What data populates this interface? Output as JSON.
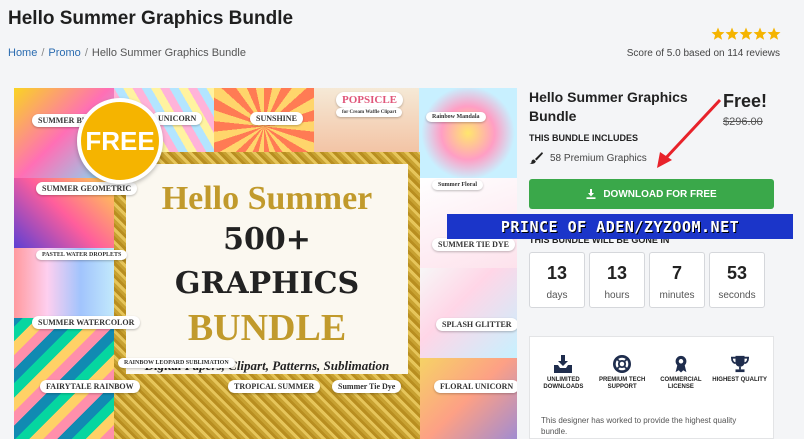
{
  "page": {
    "title": "Hello Summer Graphics Bundle",
    "rating_text": "Score of 5.0 based on 114 reviews"
  },
  "breadcrumb": {
    "home": "Home",
    "promo": "Promo",
    "current": "Hello Summer Graphics Bundle"
  },
  "hero": {
    "free_badge": "FREE",
    "line1": "Hello Summer",
    "line2": "500+ GRAPHICS",
    "line3": "BUNDLE",
    "line4": "Digital Papers, Clipart, Patterns, Sublimation",
    "tile_labels": [
      "SUMMER BU...",
      "UNICORN",
      "SUNSHINE",
      "POPSICLE",
      "for Cream Waffle Clipart",
      "Rainbow Mandala",
      "SUMMER GEOMETRIC",
      "Summer Floral",
      "SUMMER TIE DYE",
      "PASTEL WATER DROPLETS",
      "SUMMER WATERCOLOR",
      "SPLASH GLITTER",
      "FAIRYTALE RAINBOW",
      "RAINBOW LEOPARD SUBLIMATION",
      "TROPICAL SUMMER",
      "Summer Tie Dye",
      "FLORAL UNICORN"
    ]
  },
  "panel": {
    "title": "Hello Summer Graphics Bundle",
    "free_label": "Free!",
    "old_price": "$296.00",
    "includes_label": "THIS BUNDLE INCLUDES",
    "count_label": "58 Premium Graphics",
    "download_label": "DOWNLOAD FOR FREE",
    "watermark": "PRINCE OF ADEN/ZYZOOM.NET",
    "gone_label": "THIS BUNDLE WILL BE GONE IN"
  },
  "countdown": [
    {
      "value": "13",
      "unit": "days"
    },
    {
      "value": "13",
      "unit": "hours"
    },
    {
      "value": "7",
      "unit": "minutes"
    },
    {
      "value": "53",
      "unit": "seconds"
    }
  ],
  "features": [
    {
      "label": "UNLIMITED DOWNLOADS",
      "icon": "download-tray-icon"
    },
    {
      "label": "PREMIUM TECH SUPPORT",
      "icon": "lifebuoy-icon"
    },
    {
      "label": "COMMERCIAL LICENSE",
      "icon": "badge-icon"
    },
    {
      "label": "HIGHEST QUALITY",
      "icon": "trophy-icon"
    }
  ],
  "designer_note": "This designer has worked to provide the highest quality bundle.",
  "colors": {
    "star": "#f5b400",
    "download_button": "#3aa84a",
    "watermark_bg": "#1b35c9",
    "arrow": "#e8222a",
    "link": "#2b6cb0"
  }
}
